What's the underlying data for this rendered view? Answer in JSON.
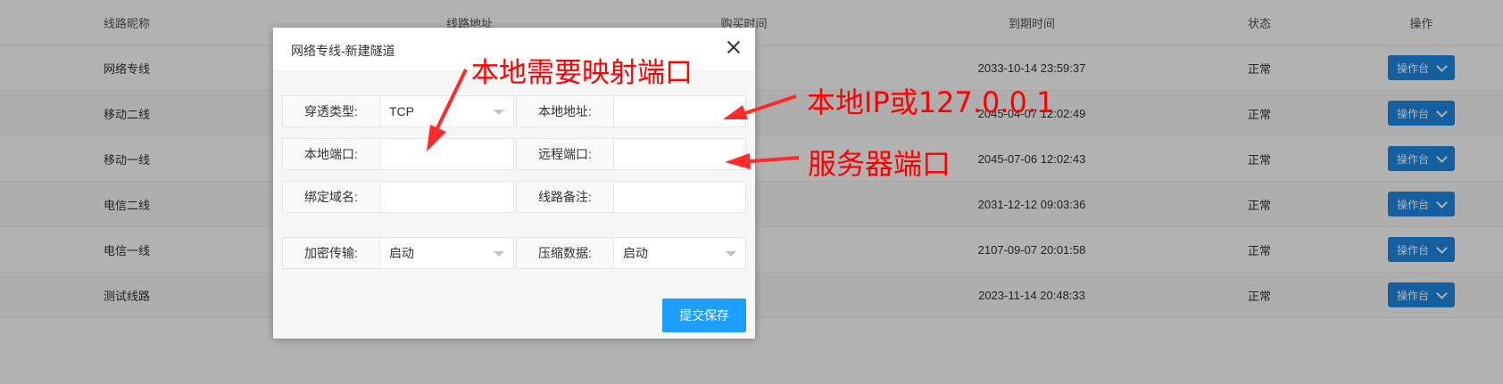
{
  "table": {
    "headers": [
      "线路昵称",
      "线路地址",
      "购买时间",
      "到期时间",
      "状态",
      "操作"
    ],
    "rows": [
      {
        "name": "网络专线",
        "address": "",
        "buy_time": "",
        "expire": "2033-10-14 23:59:37",
        "status": "正常",
        "action": "操作台"
      },
      {
        "name": "移动二线",
        "address": "",
        "buy_time": "",
        "expire": "2045-04-07 12:02:49",
        "status": "正常",
        "action": "操作台"
      },
      {
        "name": "移动一线",
        "address": "",
        "buy_time": "",
        "expire": "2045-07-06 12:02:43",
        "status": "正常",
        "action": "操作台"
      },
      {
        "name": "电信二线",
        "address": "",
        "buy_time": "",
        "expire": "2031-12-12 09:03:36",
        "status": "正常",
        "action": "操作台"
      },
      {
        "name": "电信一线",
        "address": "",
        "buy_time": "",
        "expire": "2107-09-07 20:01:58",
        "status": "正常",
        "action": "操作台"
      },
      {
        "name": "测试线路",
        "address": "",
        "buy_time": "",
        "expire": "2023-11-14 20:48:33",
        "status": "正常",
        "action": "操作台"
      }
    ]
  },
  "modal": {
    "title": "网络专线-新建隧道",
    "fields": {
      "proto_label": "穿透类型:",
      "proto_value": "TCP",
      "local_addr_label": "本地地址:",
      "local_addr_value": "",
      "local_port_label": "本地端口:",
      "local_port_value": "",
      "remote_port_label": "远程端口:",
      "remote_port_value": "",
      "domain_label": "绑定域名:",
      "domain_value": "",
      "remark_label": "线路备注:",
      "remark_value": "",
      "encrypt_label": "加密传输:",
      "encrypt_value": "启动",
      "compress_label": "压缩数据:",
      "compress_value": "启动"
    },
    "submit_label": "提交保存"
  },
  "annotations": {
    "local_port_note": "本地需要映射端口",
    "local_ip_note": "本地IP或127.0.0.1",
    "server_port_note": "服务器端口"
  },
  "colors": {
    "primary": "#1e88e5",
    "submit": "#1e9fff",
    "annotation": "#ff0000"
  }
}
